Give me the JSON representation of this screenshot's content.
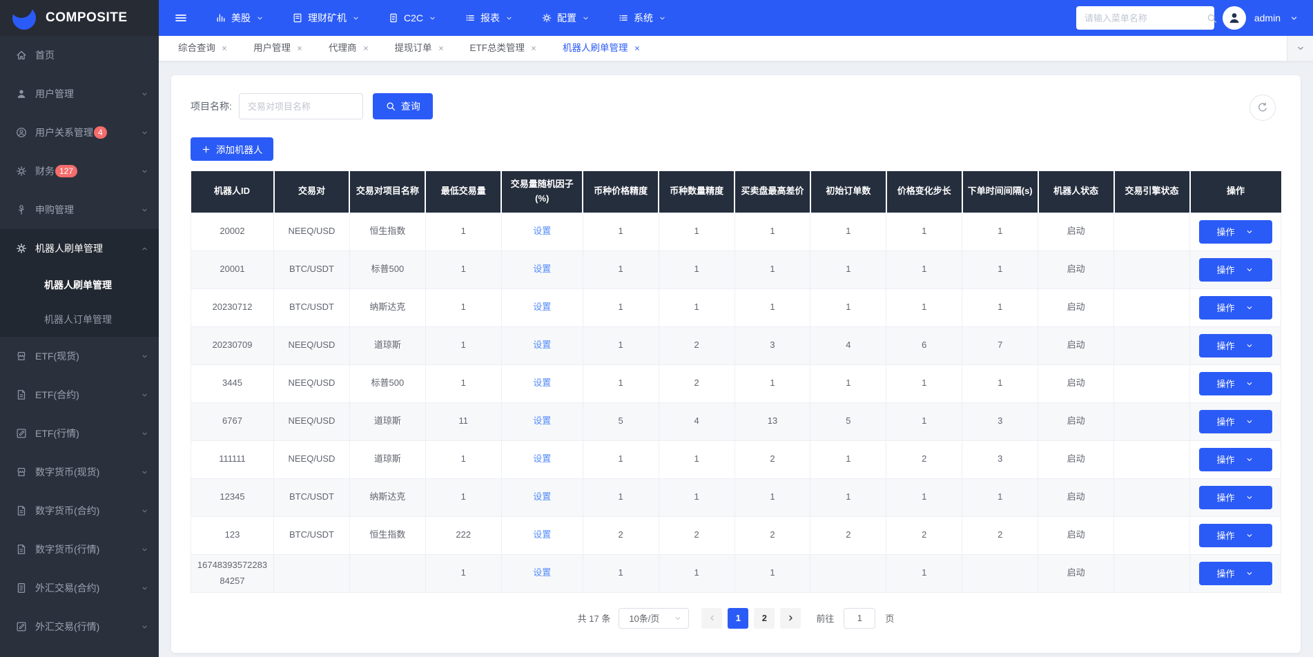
{
  "brand": {
    "name": "COMPOSITE"
  },
  "topnav": {
    "items": [
      {
        "label": "美股",
        "icon": "chart-icon"
      },
      {
        "label": "理财矿机",
        "icon": "book-icon"
      },
      {
        "label": "C2C",
        "icon": "doc-icon"
      },
      {
        "label": "报表",
        "icon": "list-icon"
      },
      {
        "label": "配置",
        "icon": "gear-icon"
      },
      {
        "label": "系统",
        "icon": "list-icon"
      }
    ],
    "search_placeholder": "请输入菜单名称",
    "username": "admin"
  },
  "sidebar": {
    "items": [
      {
        "label": "首页",
        "icon": "home-icon",
        "arrow": false
      },
      {
        "label": "用户管理",
        "icon": "user-icon",
        "arrow": true
      },
      {
        "label": "用户关系管理",
        "icon": "user-group-icon",
        "badge": "4",
        "arrow": true
      },
      {
        "label": "财务",
        "icon": "gear-icon",
        "badge": "127",
        "arrow": true
      },
      {
        "label": "申购管理",
        "icon": "subscribe-icon",
        "arrow": true
      },
      {
        "label": "机器人刷单管理",
        "icon": "gear-icon",
        "arrow": true,
        "expanded": true,
        "children": [
          {
            "label": "机器人刷单管理",
            "active": true
          },
          {
            "label": "机器人订单管理",
            "active": false
          }
        ]
      },
      {
        "label": "ETF(现货)",
        "icon": "shop-icon",
        "arrow": true
      },
      {
        "label": "ETF(合约)",
        "icon": "contract-icon",
        "arrow": true
      },
      {
        "label": "ETF(行情)",
        "icon": "edit-icon",
        "arrow": true
      },
      {
        "label": "数字货币(现货)",
        "icon": "shop-icon",
        "arrow": true
      },
      {
        "label": "数字货币(合约)",
        "icon": "contract-icon",
        "arrow": true
      },
      {
        "label": "数字货币(行情)",
        "icon": "contract-icon",
        "arrow": true
      },
      {
        "label": "外汇交易(合约)",
        "icon": "doc-icon",
        "arrow": true
      },
      {
        "label": "外汇交易(行情)",
        "icon": "edit-icon",
        "arrow": true
      }
    ]
  },
  "tabs": [
    {
      "label": "综合查询",
      "active": false
    },
    {
      "label": "用户管理",
      "active": false
    },
    {
      "label": "代理商",
      "active": false
    },
    {
      "label": "提现订单",
      "active": false
    },
    {
      "label": "ETF总类管理",
      "active": false
    },
    {
      "label": "机器人刷单管理",
      "active": true
    }
  ],
  "toolbar": {
    "filter_label": "项目名称:",
    "filter_placeholder": "交易对项目名称",
    "search_label": "查询",
    "add_label": "添加机器人"
  },
  "table": {
    "headers": [
      "机器人ID",
      "交易对",
      "交易对项目名称",
      "最低交易量",
      "交易量随机因子(%)",
      "币种价格精度",
      "币种数量精度",
      "买卖盘最高差价",
      "初始订单数",
      "价格变化步长",
      "下单时间间隔(s)",
      "机器人状态",
      "交易引擎状态",
      "操作"
    ],
    "set_link_label": "设置",
    "action_label": "操作",
    "rows": [
      [
        "20002",
        "NEEQ/USD",
        "恒生指数",
        "1",
        "设置",
        "1",
        "1",
        "1",
        "1",
        "1",
        "1",
        "启动",
        ""
      ],
      [
        "20001",
        "BTC/USDT",
        "标普500",
        "1",
        "设置",
        "1",
        "1",
        "1",
        "1",
        "1",
        "1",
        "启动",
        ""
      ],
      [
        "20230712",
        "BTC/USDT",
        "纳斯达克",
        "1",
        "设置",
        "1",
        "1",
        "1",
        "1",
        "1",
        "1",
        "启动",
        ""
      ],
      [
        "20230709",
        "NEEQ/USD",
        "道琼斯",
        "1",
        "设置",
        "1",
        "2",
        "3",
        "4",
        "6",
        "7",
        "启动",
        ""
      ],
      [
        "3445",
        "NEEQ/USD",
        "标普500",
        "1",
        "设置",
        "1",
        "2",
        "1",
        "1",
        "1",
        "1",
        "启动",
        ""
      ],
      [
        "6767",
        "NEEQ/USD",
        "道琼斯",
        "11",
        "设置",
        "5",
        "4",
        "13",
        "5",
        "1",
        "3",
        "启动",
        ""
      ],
      [
        "111111",
        "NEEQ/USD",
        "道琼斯",
        "1",
        "设置",
        "1",
        "1",
        "2",
        "1",
        "2",
        "3",
        "启动",
        ""
      ],
      [
        "12345",
        "BTC/USDT",
        "纳斯达克",
        "1",
        "设置",
        "1",
        "1",
        "1",
        "1",
        "1",
        "1",
        "启动",
        ""
      ],
      [
        "123",
        "BTC/USDT",
        "恒生指数",
        "222",
        "设置",
        "2",
        "2",
        "2",
        "2",
        "2",
        "2",
        "启动",
        ""
      ],
      [
        "1674839357228384257",
        "",
        "",
        "1",
        "设置",
        "1",
        "1",
        "1",
        "",
        "1",
        "",
        "启动",
        ""
      ]
    ]
  },
  "pagination": {
    "total": "共 17 条",
    "page_size": "10条/页",
    "pages": [
      "1",
      "2"
    ],
    "current": "1",
    "goto_label": "前往",
    "goto_value": "1",
    "unit_label": "页"
  },
  "colors": {
    "accent_blue": "#2b5bf6",
    "header_dark": "#252e3d",
    "sidebar_dark": "#2b313c",
    "badge_red": "#f56c6c",
    "link_blue": "#548cf8"
  }
}
